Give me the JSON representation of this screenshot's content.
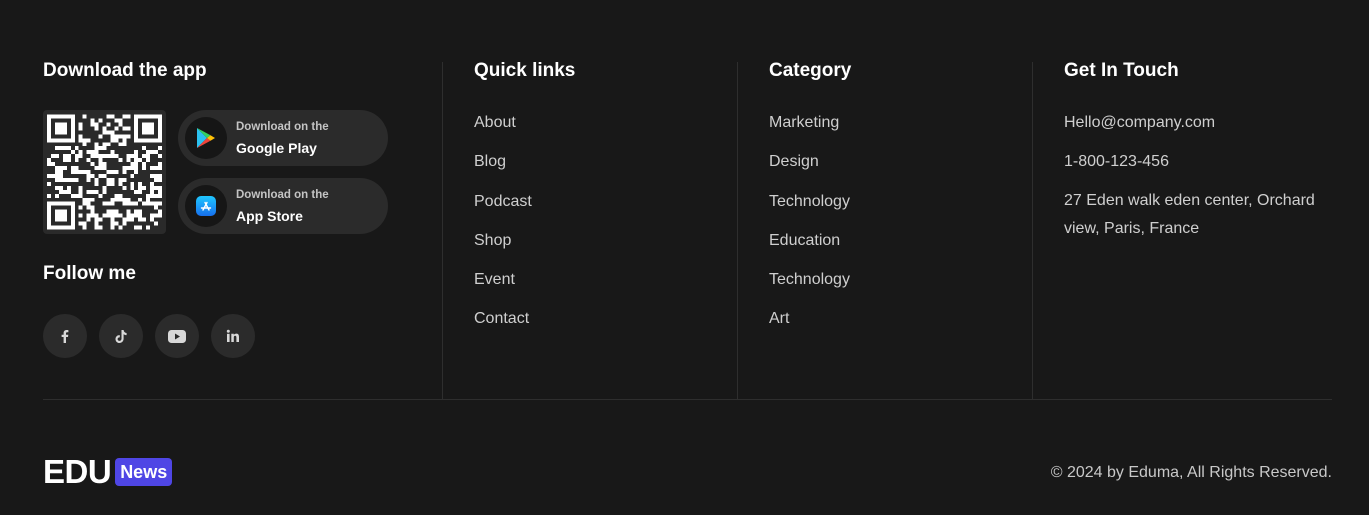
{
  "download": {
    "heading": "Download the app",
    "google_play": {
      "small": "Download on the",
      "big": "Google Play"
    },
    "app_store": {
      "small": "Download on the",
      "big": "App Store"
    }
  },
  "follow": {
    "heading": "Follow me",
    "socials": [
      "facebook-icon",
      "tiktok-icon",
      "youtube-icon",
      "linkedin-icon"
    ]
  },
  "quick_links": {
    "heading": "Quick links",
    "items": [
      "About",
      "Blog",
      "Podcast",
      "Shop",
      "Event",
      "Contact"
    ]
  },
  "category": {
    "heading": "Category",
    "items": [
      "Marketing",
      "Design",
      "Technology",
      "Education",
      "Technology",
      "Art"
    ]
  },
  "contact": {
    "heading": "Get In Touch",
    "email": "Hello@company.com",
    "phone": "1-800-123-456",
    "address": "27 Eden walk eden center, Orchard view, Paris, France"
  },
  "brand": {
    "logo_text": "EDU",
    "logo_badge": "News",
    "accent": "#4f46e5"
  },
  "copyright": "© 2024 by Eduma, All Rights Reserved."
}
